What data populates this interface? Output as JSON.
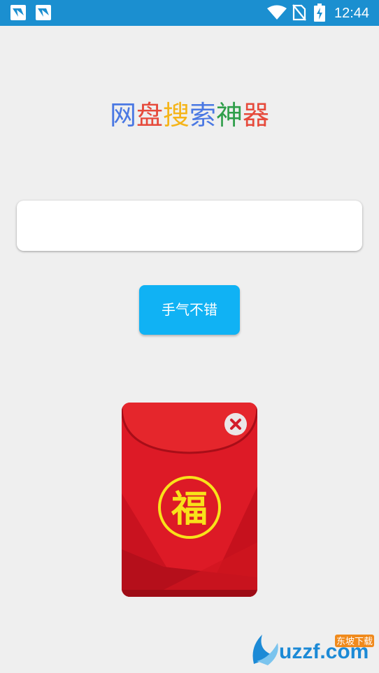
{
  "status_bar": {
    "time": "12:44",
    "background_color": "#1b8fd0",
    "icons": [
      "app-notification-icon",
      "app-notification-icon",
      "wifi-icon",
      "no-sim-icon",
      "battery-charging-icon"
    ]
  },
  "title": {
    "chars": [
      {
        "text": "网",
        "color": "#4a78e3"
      },
      {
        "text": "盘",
        "color": "#e64a3b"
      },
      {
        "text": "搜",
        "color": "#f5b418"
      },
      {
        "text": "索",
        "color": "#4a78e3"
      },
      {
        "text": "神",
        "color": "#2f9e4a"
      },
      {
        "text": "器",
        "color": "#e64a3b"
      }
    ]
  },
  "search": {
    "value": "",
    "placeholder": ""
  },
  "luck_button": {
    "label": "手气不错",
    "color": "#10b2f4"
  },
  "red_envelope": {
    "symbol": "福",
    "envelope_color": "#e01e2b",
    "symbol_color": "#f8e21a",
    "close_icon": "close-icon"
  },
  "watermark": {
    "brand": "uzzf.com",
    "tag": "东坡下载"
  }
}
